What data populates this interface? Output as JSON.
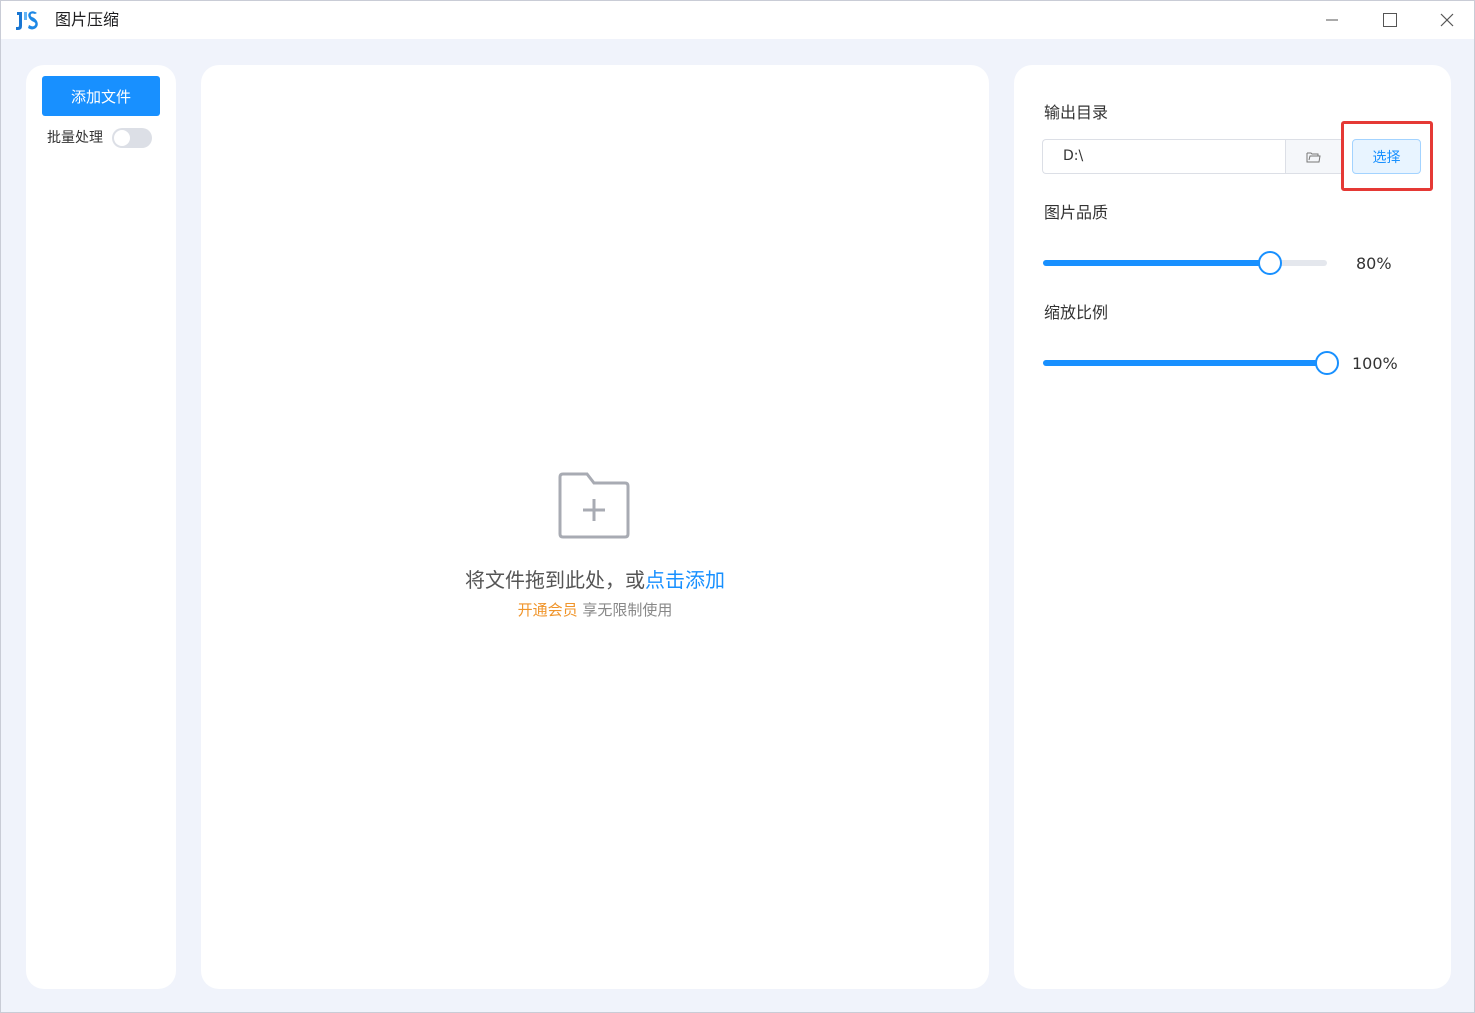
{
  "window": {
    "title": "图片压缩",
    "controls": [
      "minimize",
      "maximize",
      "close"
    ]
  },
  "sidebar": {
    "add_button_label": "添加文件",
    "batch_label": "批量处理",
    "batch_enabled": false
  },
  "drop_zone": {
    "icon": "folder-add-icon",
    "text_prefix": "将文件拖到此处，或",
    "text_link": "点击添加",
    "vip_link": "开通会员",
    "vip_text": "享无限制使用"
  },
  "settings": {
    "output_dir_label": "输出目录",
    "output_dir_value": "D:\\",
    "choose_button_label": "选择",
    "quality_label": "图片品质",
    "quality_value": 80,
    "quality_display": "80%",
    "scale_label": "缩放比例",
    "scale_value": 100,
    "scale_display": "100%"
  },
  "colors": {
    "accent": "#1890ff",
    "vip": "#f0952b",
    "highlight": "#e53935",
    "background": "#f0f3fb"
  }
}
